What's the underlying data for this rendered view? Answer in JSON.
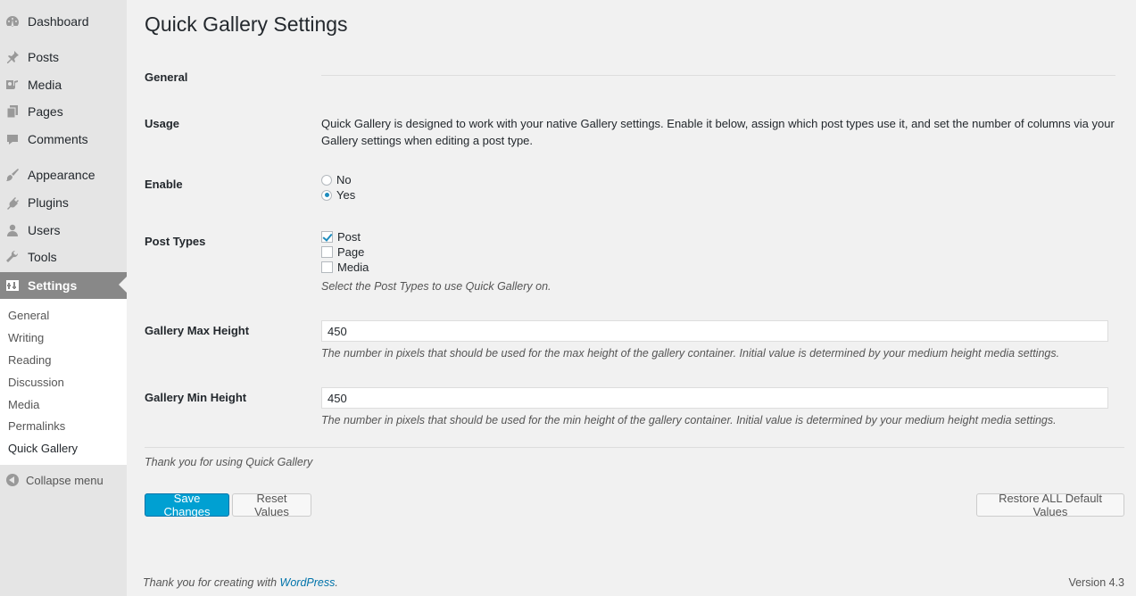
{
  "sidebar": {
    "items": [
      {
        "label": "Dashboard",
        "icon": "dashboard-icon"
      },
      {
        "label": "Posts",
        "icon": "pin-icon"
      },
      {
        "label": "Media",
        "icon": "media-icon"
      },
      {
        "label": "Pages",
        "icon": "pages-icon"
      },
      {
        "label": "Comments",
        "icon": "comment-icon"
      },
      {
        "label": "Appearance",
        "icon": "brush-icon"
      },
      {
        "label": "Plugins",
        "icon": "plugin-icon"
      },
      {
        "label": "Users",
        "icon": "user-icon"
      },
      {
        "label": "Tools",
        "icon": "wrench-icon"
      },
      {
        "label": "Settings",
        "icon": "settings-icon"
      }
    ],
    "submenu": [
      "General",
      "Writing",
      "Reading",
      "Discussion",
      "Media",
      "Permalinks",
      "Quick Gallery"
    ],
    "collapse_label": "Collapse menu",
    "active_bg": "#888888"
  },
  "page": {
    "title": "Quick Gallery Settings",
    "general_label": "General",
    "usage_label": "Usage",
    "usage_text": "Quick Gallery is designed to work with your native Gallery settings. Enable it below, assign which post types use it, and set the number of columns via your Gallery settings when editing a post type.",
    "enable_label": "Enable",
    "enable_options": [
      {
        "label": "No",
        "checked": false
      },
      {
        "label": "Yes",
        "checked": true
      }
    ],
    "post_types_label": "Post Types",
    "post_types": [
      {
        "label": "Post",
        "checked": true
      },
      {
        "label": "Page",
        "checked": false
      },
      {
        "label": "Media",
        "checked": false
      }
    ],
    "post_types_note": "Select the Post Types to use Quick Gallery on.",
    "max_height_label": "Gallery Max Height",
    "max_height_value": "450",
    "max_height_note": "The number in pixels that should be used for the max height of the gallery container. Initial value is determined by your medium height media settings.",
    "min_height_label": "Gallery Min Height",
    "min_height_value": "450",
    "min_height_note": "The number in pixels that should be used for the min height of the gallery container. Initial value is determined by your medium height media settings.",
    "thanks_text": "Thank you for using Quick Gallery",
    "save_label": "Save Changes",
    "reset_label": "Reset Values",
    "restore_label": "Restore ALL Default Values"
  },
  "footer": {
    "left_text": "Thank you for creating with ",
    "left_link": "WordPress",
    "left_suffix": ".",
    "version": "Version 4.3"
  },
  "colors": {
    "primary_button": "#00a0d2",
    "accent": "#1e8cbe",
    "link": "#0073aa"
  }
}
